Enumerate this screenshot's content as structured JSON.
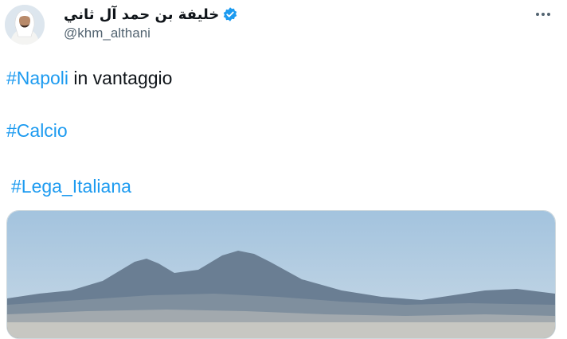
{
  "author": {
    "display_name": "خليفة بن حمد آل ثاني",
    "handle": "@khm_althani",
    "verified": true
  },
  "tweet": {
    "lines": [
      {
        "hashtag": "#Napoli",
        "text": " in vantaggio"
      },
      {
        "hashtag": "#Calcio"
      },
      {
        "hashtag": "#Lega_Italiana"
      }
    ]
  },
  "icons": {
    "verified": "verified-badge-icon",
    "more": "more-options-icon"
  },
  "colors": {
    "link": "#1d9bf0",
    "text": "#0f1419",
    "secondary": "#536471",
    "sky": "#a9c8e2"
  }
}
